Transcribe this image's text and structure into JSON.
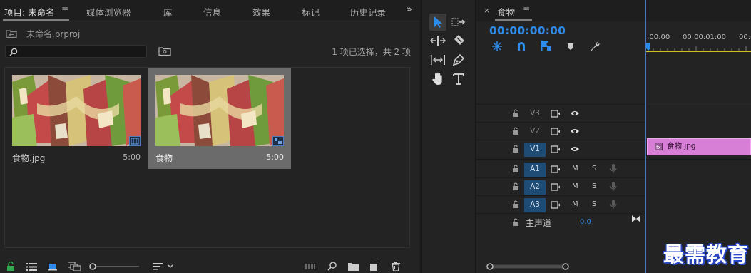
{
  "project_panel": {
    "tabs": [
      {
        "label": "项目: 未命名"
      },
      {
        "label": "媒体浏览器"
      },
      {
        "label": "库"
      },
      {
        "label": "信息"
      },
      {
        "label": "效果"
      },
      {
        "label": "标记"
      },
      {
        "label": "历史记录"
      }
    ],
    "file_name": "未命名.prproj",
    "search_placeholder": "",
    "selection_text": "1 项已选择，共 2 项",
    "items": [
      {
        "name": "食物.jpg",
        "duration": "5:00",
        "selected": false
      },
      {
        "name": "食物",
        "duration": "5:00",
        "selected": true
      }
    ]
  },
  "timeline": {
    "sequence_name": "食物",
    "timecode": "00:00:00:00",
    "ruler_labels": [
      ":00:00",
      "00:00:01:00",
      "00:0"
    ],
    "video_tracks": [
      {
        "name": "V3",
        "targeted": false
      },
      {
        "name": "V2",
        "targeted": false
      },
      {
        "name": "V1",
        "targeted": true
      }
    ],
    "audio_tracks": [
      {
        "name": "A1",
        "m": "M",
        "s": "S"
      },
      {
        "name": "A2",
        "m": "M",
        "s": "S"
      },
      {
        "name": "A3",
        "m": "M",
        "s": "S"
      }
    ],
    "master": {
      "label": "主声道",
      "value": "0.0"
    },
    "clip": {
      "label": "食物.jpg",
      "color": "#d77fd6"
    }
  },
  "watermark": "最需教育",
  "colors": {
    "accent_blue": "#2d8ceb",
    "timecode_blue": "#2d8ceb",
    "clip_pink": "#d77fd6",
    "lock_green": "#2fa84f"
  }
}
